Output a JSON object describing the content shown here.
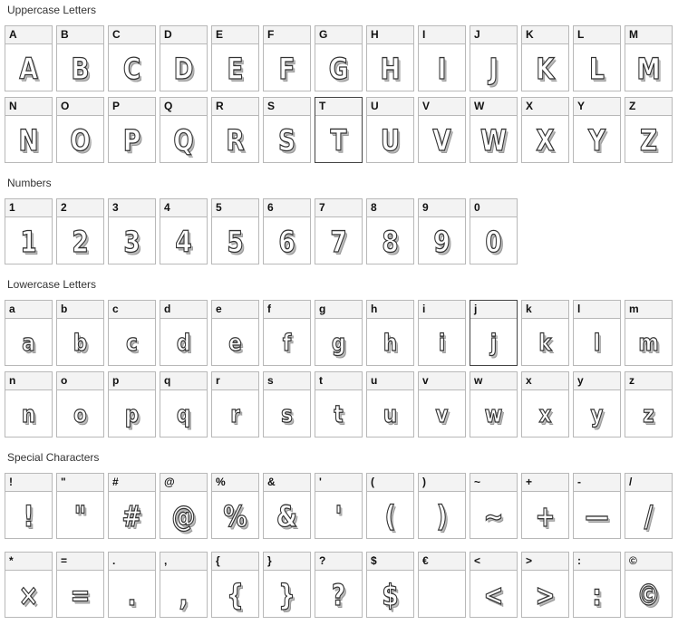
{
  "sections": [
    {
      "title": "Uppercase Letters",
      "rows": [
        [
          {
            "label": "A",
            "glyph": "A"
          },
          {
            "label": "B",
            "glyph": "B"
          },
          {
            "label": "C",
            "glyph": "C"
          },
          {
            "label": "D",
            "glyph": "D"
          },
          {
            "label": "E",
            "glyph": "E"
          },
          {
            "label": "F",
            "glyph": "F"
          },
          {
            "label": "G",
            "glyph": "G"
          },
          {
            "label": "H",
            "glyph": "H"
          },
          {
            "label": "I",
            "glyph": "I"
          },
          {
            "label": "J",
            "glyph": "J"
          },
          {
            "label": "K",
            "glyph": "K"
          },
          {
            "label": "L",
            "glyph": "L"
          },
          {
            "label": "M",
            "glyph": "M"
          }
        ],
        [
          {
            "label": "N",
            "glyph": "N"
          },
          {
            "label": "O",
            "glyph": "O"
          },
          {
            "label": "P",
            "glyph": "P"
          },
          {
            "label": "Q",
            "glyph": "Q"
          },
          {
            "label": "R",
            "glyph": "R"
          },
          {
            "label": "S",
            "glyph": "S"
          },
          {
            "label": "T",
            "glyph": "T",
            "highlighted": true
          },
          {
            "label": "U",
            "glyph": "U"
          },
          {
            "label": "V",
            "glyph": "V"
          },
          {
            "label": "W",
            "glyph": "W"
          },
          {
            "label": "X",
            "glyph": "X"
          },
          {
            "label": "Y",
            "glyph": "Y"
          },
          {
            "label": "Z",
            "glyph": "Z"
          }
        ]
      ]
    },
    {
      "title": "Numbers",
      "rows": [
        [
          {
            "label": "1",
            "glyph": "1"
          },
          {
            "label": "2",
            "glyph": "2"
          },
          {
            "label": "3",
            "glyph": "3"
          },
          {
            "label": "4",
            "glyph": "4"
          },
          {
            "label": "5",
            "glyph": "5"
          },
          {
            "label": "6",
            "glyph": "6"
          },
          {
            "label": "7",
            "glyph": "7"
          },
          {
            "label": "8",
            "glyph": "8"
          },
          {
            "label": "9",
            "glyph": "9"
          },
          {
            "label": "0",
            "glyph": "0"
          }
        ]
      ]
    },
    {
      "title": "Lowercase Letters",
      "rows": [
        [
          {
            "label": "a",
            "glyph": "a"
          },
          {
            "label": "b",
            "glyph": "b"
          },
          {
            "label": "c",
            "glyph": "c"
          },
          {
            "label": "d",
            "glyph": "d"
          },
          {
            "label": "e",
            "glyph": "e"
          },
          {
            "label": "f",
            "glyph": "f"
          },
          {
            "label": "g",
            "glyph": "g"
          },
          {
            "label": "h",
            "glyph": "h"
          },
          {
            "label": "i",
            "glyph": "i"
          },
          {
            "label": "j",
            "glyph": "j",
            "highlighted": true
          },
          {
            "label": "k",
            "glyph": "k"
          },
          {
            "label": "l",
            "glyph": "l"
          },
          {
            "label": "m",
            "glyph": "m"
          }
        ],
        [
          {
            "label": "n",
            "glyph": "n"
          },
          {
            "label": "o",
            "glyph": "o"
          },
          {
            "label": "p",
            "glyph": "p"
          },
          {
            "label": "q",
            "glyph": "q"
          },
          {
            "label": "r",
            "glyph": "r"
          },
          {
            "label": "s",
            "glyph": "s"
          },
          {
            "label": "t",
            "glyph": "t"
          },
          {
            "label": "u",
            "glyph": "u"
          },
          {
            "label": "v",
            "glyph": "v"
          },
          {
            "label": "w",
            "glyph": "w"
          },
          {
            "label": "x",
            "glyph": "x"
          },
          {
            "label": "y",
            "glyph": "y"
          },
          {
            "label": "z",
            "glyph": "z"
          }
        ]
      ]
    },
    {
      "title": "Special Characters",
      "rows": [
        [
          {
            "label": "!",
            "glyph": "!"
          },
          {
            "label": "\"",
            "glyph": "\""
          },
          {
            "label": "#",
            "glyph": "#"
          },
          {
            "label": "@",
            "glyph": "@"
          },
          {
            "label": "%",
            "glyph": "%"
          },
          {
            "label": "&",
            "glyph": "&"
          },
          {
            "label": "'",
            "glyph": "'"
          },
          {
            "label": "(",
            "glyph": "("
          },
          {
            "label": ")",
            "glyph": ")"
          },
          {
            "label": "~",
            "glyph": "~"
          },
          {
            "label": "+",
            "glyph": "+"
          },
          {
            "label": "-",
            "glyph": "—"
          },
          {
            "label": "/",
            "glyph": "/"
          }
        ],
        [
          {
            "label": "*",
            "glyph": "×"
          },
          {
            "label": "=",
            "glyph": "="
          },
          {
            "label": ".",
            "glyph": "."
          },
          {
            "label": ",",
            "glyph": ","
          },
          {
            "label": "{",
            "glyph": "{"
          },
          {
            "label": "}",
            "glyph": "}"
          },
          {
            "label": "?",
            "glyph": "?"
          },
          {
            "label": "$",
            "glyph": "$"
          },
          {
            "label": "€",
            "glyph": ""
          },
          {
            "label": "<",
            "glyph": "<"
          },
          {
            "label": ">",
            "glyph": ">"
          },
          {
            "label": ":",
            "glyph": ":"
          },
          {
            "label": "©",
            "glyph": "©"
          }
        ]
      ]
    }
  ]
}
